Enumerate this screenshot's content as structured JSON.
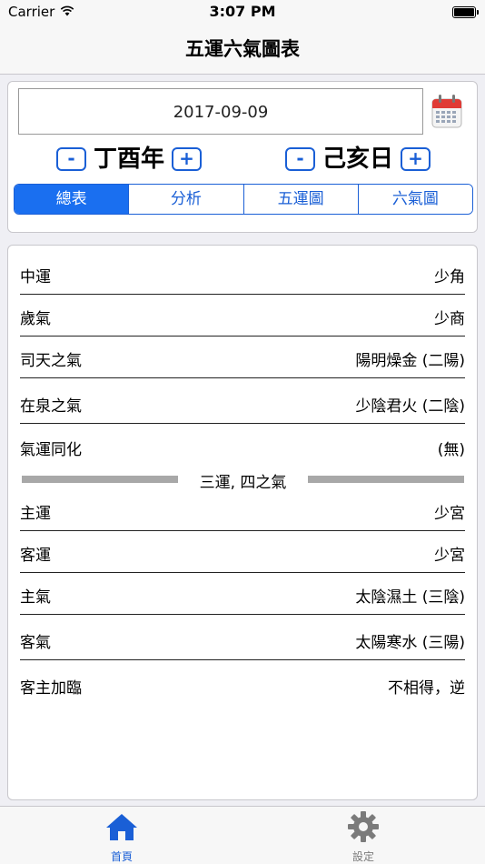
{
  "status_bar": {
    "carrier": "Carrier",
    "time": "3:07 PM"
  },
  "nav": {
    "title": "五運六氣圖表"
  },
  "date_picker": {
    "value": "2017-09-09"
  },
  "year_stepper": {
    "minus": "-",
    "label": "丁酉年",
    "plus": "+"
  },
  "day_stepper": {
    "minus": "-",
    "label": "己亥日",
    "plus": "+"
  },
  "segments": [
    {
      "label": "總表",
      "active": true
    },
    {
      "label": "分析",
      "active": false
    },
    {
      "label": "五運圖",
      "active": false
    },
    {
      "label": "六氣圖",
      "active": false
    }
  ],
  "rows_top": [
    {
      "label": "中運",
      "value": "少角"
    },
    {
      "label": "歲氣",
      "value": "少商"
    },
    {
      "label": "司天之氣",
      "value": "陽明燥金 (二陽)"
    },
    {
      "label": "在泉之氣",
      "value": "少陰君火 (二陰)"
    },
    {
      "label": "氣運同化",
      "value": "(無)"
    }
  ],
  "section_divider": "三運, 四之氣",
  "rows_bottom": [
    {
      "label": "主運",
      "value": "少宮"
    },
    {
      "label": "客運",
      "value": "少宮"
    },
    {
      "label": "主氣",
      "value": "太陰濕土 (三陰)"
    },
    {
      "label": "客氣",
      "value": "太陽寒水 (三陽)"
    },
    {
      "label": "客主加臨",
      "value": "不相得，逆"
    }
  ],
  "tabs": {
    "home": "首頁",
    "settings": "設定"
  },
  "colors": {
    "accent": "#1a5fd6",
    "active_segment": "#1a6ff0",
    "divider_bar": "#a8a8a8"
  },
  "icons": {
    "calendar": "calendar-icon",
    "home": "home-icon",
    "settings": "gear-icon",
    "wifi": "wifi-icon",
    "battery": "battery-icon"
  }
}
